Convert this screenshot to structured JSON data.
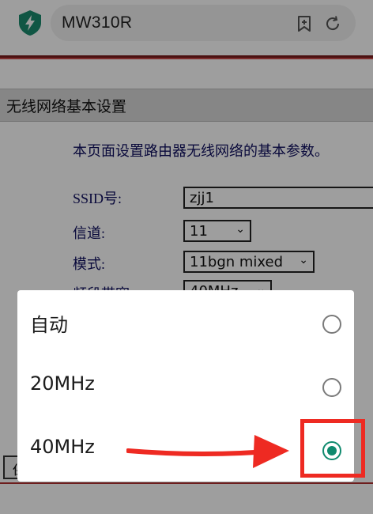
{
  "browser": {
    "url_text": "MW310R",
    "icons": [
      "shield-bolt-icon",
      "bookmark-add-icon",
      "reload-icon"
    ],
    "accent": "#1a8c6e"
  },
  "page": {
    "section_title": "无线网络基本设置",
    "description": "本页面设置路由器无线网络的基本参数。",
    "fields": [
      {
        "label": "SSID号:",
        "value": "zjj1"
      },
      {
        "label": "信道:",
        "value": "11"
      },
      {
        "label": "模式:",
        "value": "11bgn mixed"
      },
      {
        "label": "频段带宽:",
        "value": "40MHz"
      }
    ],
    "bottom_button_1": "保",
    "bottom_button_2": ""
  },
  "dialog": {
    "options": [
      {
        "label": "自动",
        "selected": false
      },
      {
        "label": "20MHz",
        "selected": false
      },
      {
        "label": "40MHz",
        "selected": true
      }
    ],
    "selected_color": "#0f8a6e"
  },
  "annotation": {
    "arrow_color": "#ee2a22",
    "highlight_color": "#ee2a22"
  }
}
